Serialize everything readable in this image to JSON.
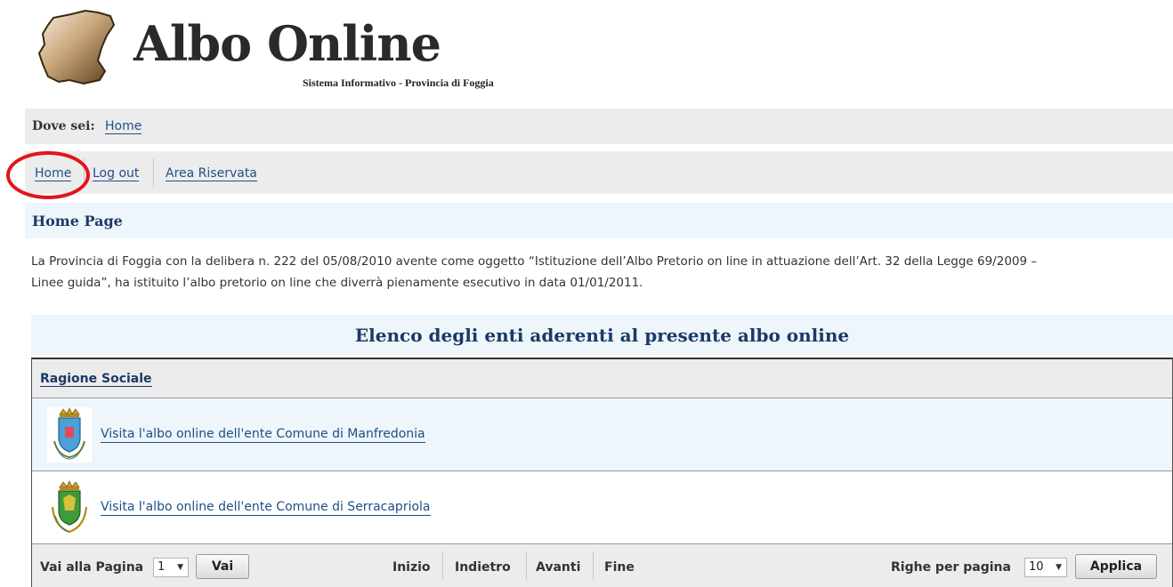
{
  "header": {
    "title": "Albo Online",
    "subtitle": "Sistema Informativo - Provincia di Foggia"
  },
  "breadcrumb": {
    "label": "Dove sei:",
    "current": "Home"
  },
  "menu": {
    "items": [
      {
        "label": "Home"
      },
      {
        "label": "Log out"
      },
      {
        "label": "Area Riservata"
      }
    ],
    "highlight_color": "#e2141c"
  },
  "page": {
    "title": "Home Page",
    "intro_line1": "La Provincia di Foggia con la delibera n. 222 del 05/08/2010 avente come oggetto “Istituzione dell’Albo Pretorio on line in attuazione dell’Art. 32 della Legge 69/2009 –",
    "intro_line2": "Linee guida”, ha istituito l’albo pretorio on line che diverrà pienamente esecutivo in data 01/01/2011."
  },
  "table": {
    "caption": "Elenco degli enti aderenti al presente albo online",
    "column_header": "Ragione Sociale",
    "rows": [
      {
        "link": "Visita l'albo online dell'ente Comune di Manfredonia",
        "icon": "crest-icon"
      },
      {
        "link": "Visita l'albo online dell'ente Comune di Serracapriola",
        "icon": "crest-icon"
      }
    ]
  },
  "pager": {
    "goto_label": "Vai alla Pagina",
    "page_value": "1",
    "go_button": "Vai",
    "nav": [
      "Inizio",
      "Indietro",
      "Avanti",
      "Fine"
    ],
    "rows_label": "Righe per pagina",
    "rows_value": "10",
    "apply_button": "Applica"
  },
  "colors": {
    "link": "#1f4f86",
    "heading": "#1a3a66",
    "bar_bg": "#ececec",
    "light_blue_bg": "#eef5fb"
  }
}
